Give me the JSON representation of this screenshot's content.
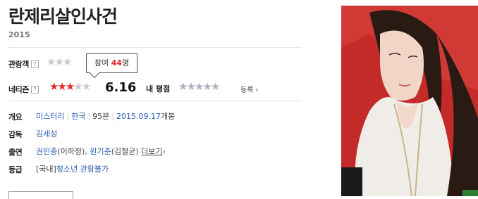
{
  "movie": {
    "title": "란제리살인사건",
    "year": "2015"
  },
  "ratings": {
    "audience_label": "관람객",
    "help_symbol": "?",
    "netizen_label": "네티즌",
    "netizen_score": "6.16",
    "netizen_stars_filled": 3,
    "netizen_stars_total": 5,
    "my_rating_label": "내 평점",
    "register_label": "등록",
    "register_arrow": "›",
    "star_glyph": "★"
  },
  "tooltip": {
    "prefix": "참여",
    "count": "44",
    "suffix": "명"
  },
  "info": {
    "overview_label": "개요",
    "genre": "미스터리",
    "country": "한국",
    "runtime": "95분",
    "release_date": "2015.09.17",
    "release_suffix": "개봉",
    "director_label": "감독",
    "director": "김세성",
    "cast_label": "출연",
    "cast": [
      {
        "name": "권민중",
        "role": "(이하정)"
      },
      {
        "name": "원기준",
        "role": "(김철균)"
      }
    ],
    "more_label": "더보기",
    "more_arrow": "›",
    "grade_label": "등급",
    "grade_prefix": "[국내]",
    "grade": "청소년 관람불가"
  },
  "colors": {
    "star_on": "#e5292b",
    "star_off": "#c9c9c9",
    "link": "#2b5eb1",
    "poster_background": "#c42a28"
  }
}
